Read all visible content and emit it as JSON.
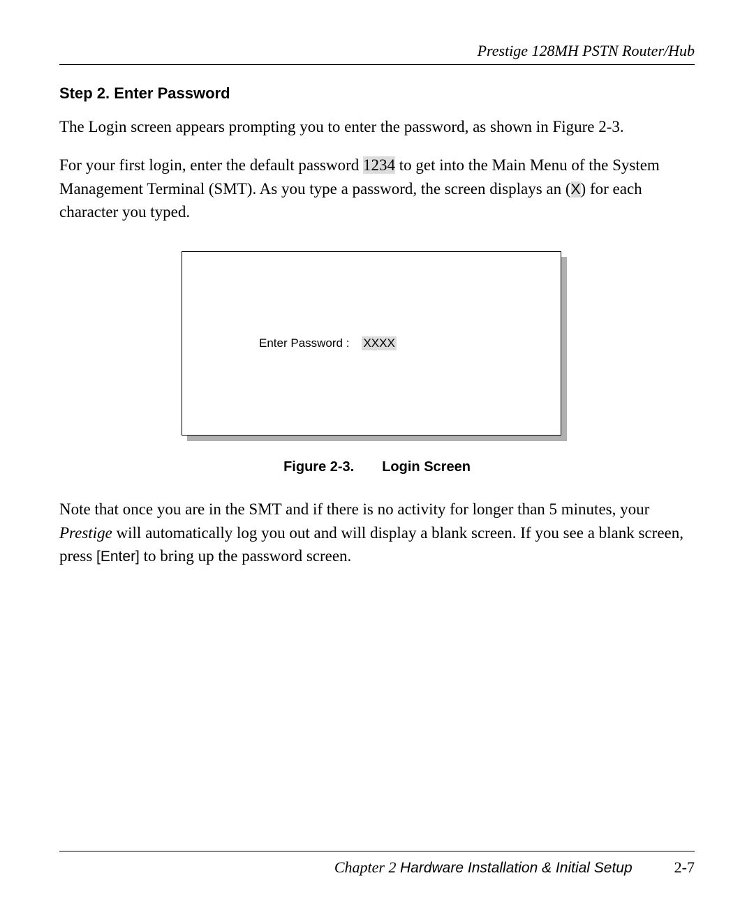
{
  "header": {
    "running_head": "Prestige 128MH    PSTN Router/Hub"
  },
  "step": {
    "heading": "Step 2.    Enter Password"
  },
  "para1": {
    "text": "The Login screen appears prompting you to enter the password, as shown in Figure 2-3."
  },
  "para2": {
    "pre": "For your first login, enter the default password ",
    "code": "1234",
    "mid": " to get into the Main Menu of the System Management Terminal (SMT). As you type a password, the screen displays an (",
    "x": "X",
    "post": ") for each character you typed."
  },
  "login_box": {
    "label": "Enter   Password :",
    "value": "XXXX"
  },
  "figure_caption": {
    "num": "Figure 2-3.",
    "title": "Login Screen"
  },
  "para3": {
    "pre": "Note that once you are in the SMT and if there is no activity for longer than 5 minutes, your ",
    "product": "Prestige",
    "mid": " will automatically log you out and will display a blank screen. If you see a blank screen, press ",
    "key": "[Enter]",
    "post": " to bring up the password screen."
  },
  "footer": {
    "chapter": "Chapter 2 ",
    "title": "Hardware Installation & Initial Setup",
    "page": "2-7"
  }
}
